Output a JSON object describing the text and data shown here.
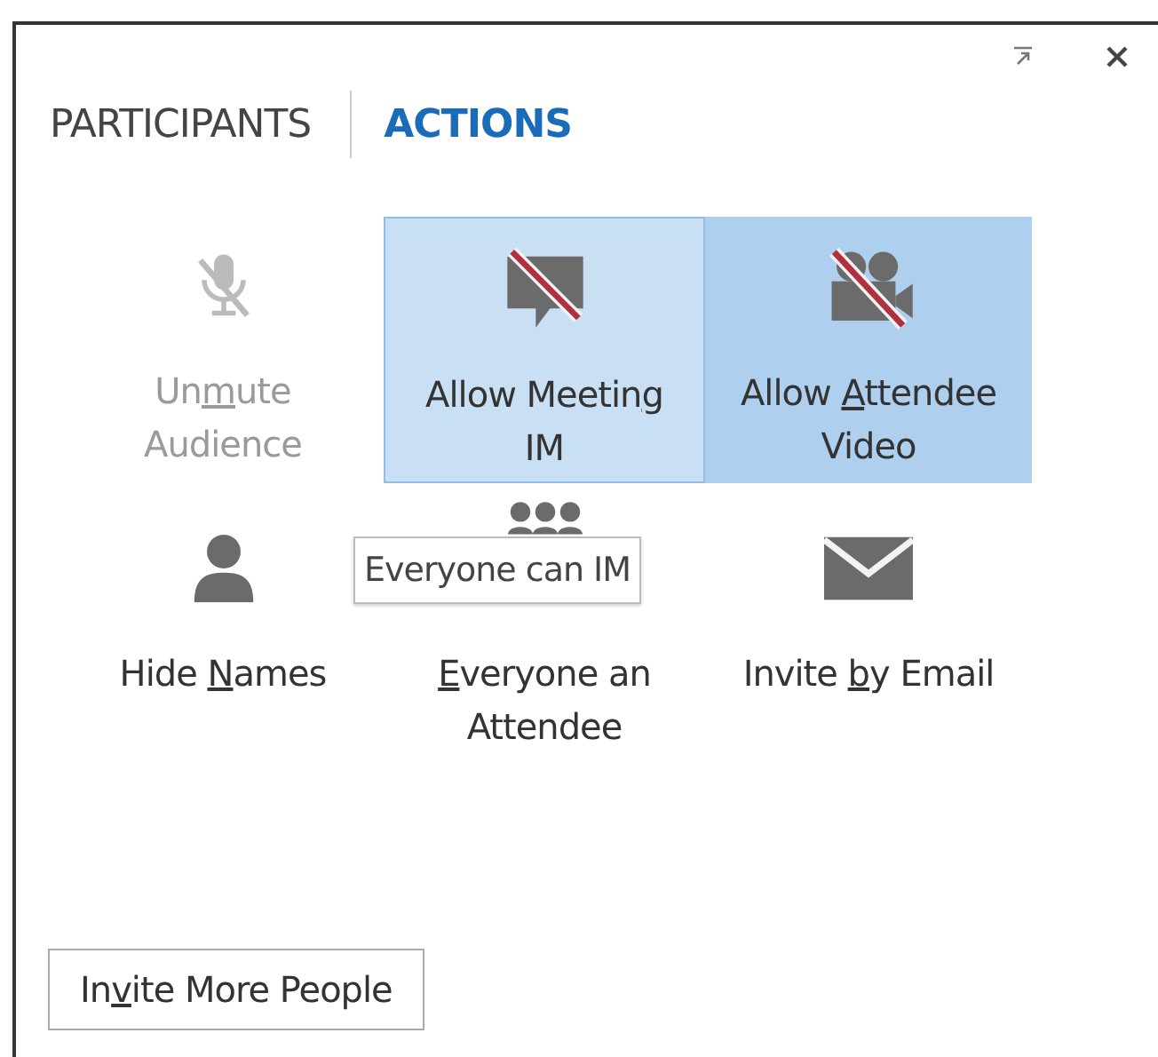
{
  "tabs": [
    {
      "label": "PARTICIPANTS",
      "selected": false
    },
    {
      "label": "ACTIONS",
      "selected": true
    }
  ],
  "actions": [
    {
      "label": {
        "before": "Un",
        "key": "m",
        "after": "ute\nAudience"
      },
      "kind": "mic-off",
      "disabled": true,
      "on": false,
      "hovered": false
    },
    {
      "label": {
        "before": "Allow Meetin",
        "key": "g",
        "after": "\nIM"
      },
      "kind": "chat-off",
      "disabled": false,
      "on": true,
      "hovered": true
    },
    {
      "label": {
        "before": "Allow ",
        "key": "A",
        "after": "ttendee\nVideo"
      },
      "kind": "video-off",
      "disabled": false,
      "on": true,
      "hovered": false
    },
    {
      "label": {
        "before": "Hide ",
        "key": "N",
        "after": "ames"
      },
      "kind": "person",
      "disabled": false,
      "on": false,
      "hovered": false
    },
    {
      "label": {
        "key": "E",
        "after": "veryone an\nAttendee"
      },
      "kind": "group",
      "disabled": false,
      "on": false,
      "hovered": false,
      "tooltip": "Everyone can IM"
    },
    {
      "label": {
        "before": "Invite ",
        "key": "b",
        "after": "y Email"
      },
      "kind": "mail",
      "disabled": false,
      "on": false,
      "hovered": false
    }
  ],
  "invite_button": {
    "before": "In",
    "key": "v",
    "after": "ite More People"
  }
}
